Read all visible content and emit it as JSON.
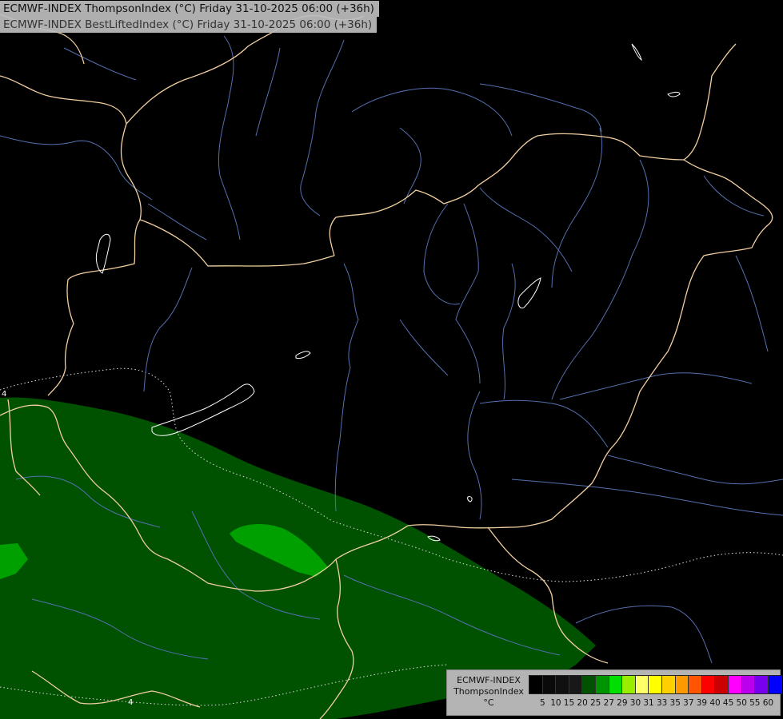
{
  "titles": {
    "line1": "ECMWF-INDEX ThompsonIndex (°C) Friday 31-10-2025 06:00 (+36h)",
    "line2": "ECMWF-INDEX BestLiftedIndex (°C) Friday 31-10-2025 06:00 (+36h)"
  },
  "legend": {
    "model": "ECMWF-INDEX",
    "parameter": "ThompsonIndex",
    "unit": "°C",
    "ticks": [
      "5",
      "10",
      "15",
      "20",
      "25",
      "27",
      "29",
      "30",
      "31",
      "33",
      "35",
      "37",
      "39",
      "40",
      "45",
      "50",
      "55",
      "60"
    ],
    "colors": [
      "#000000",
      "#0a0a0a",
      "#101010",
      "#181818",
      "#005200",
      "#009400",
      "#00e000",
      "#99ee00",
      "#ffff66",
      "#ffff00",
      "#ffd000",
      "#ff9900",
      "#ff5500",
      "#ff0000",
      "#cc0000",
      "#ff00ff",
      "#bb00ee",
      "#7700ee",
      "#0000ff"
    ]
  },
  "map": {
    "contour_labels": [
      "4",
      "4"
    ],
    "colors": {
      "background": "#000000",
      "border": "#f2cfa0",
      "river": "#5570b0",
      "coast": "#ffffff",
      "contour": "#ffffff",
      "fill_dark": "#005200",
      "fill_bright": "#00a000"
    }
  }
}
